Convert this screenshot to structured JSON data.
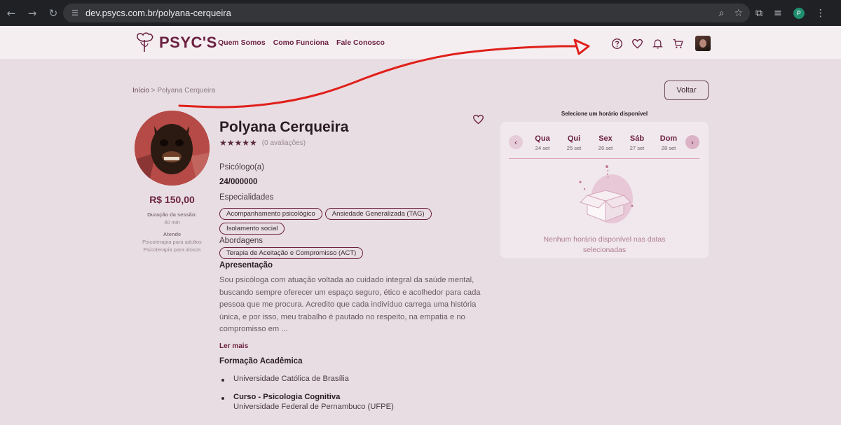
{
  "browser": {
    "url": "dev.psycs.com.br/polyana-cerqueira",
    "profile_initial": "P"
  },
  "header": {
    "logo_text": "PSYC'S",
    "nav": [
      "Quem Somos",
      "Como Funciona",
      "Fale Conosco"
    ]
  },
  "breadcrumb": {
    "home": "Início",
    "separator": " > ",
    "current": "Polyana Cerqueira"
  },
  "back_button": "Voltar",
  "profile": {
    "name": "Polyana Cerqueira",
    "rating": 5,
    "stars": "★★★★★",
    "reviews": "(0 avaliações)",
    "price": "R$ 150,00",
    "session_label": "Duração da sessão:",
    "session_value": "40 min",
    "attends_label": "Atende",
    "attends": [
      "Psicoterapia para adultos",
      "Psicoterapia para idosos"
    ],
    "role": "Psicólogo(a)",
    "crp": "24/000000",
    "specialties_label": "Especialidades",
    "specialties": [
      "Acompanhamento psicológico",
      "Ansiedade Generalizada (TAG)",
      "Isolamento social"
    ],
    "approaches_label": "Abordagens",
    "approaches": [
      "Terapia de Aceitação e Compromisso (ACT)"
    ],
    "presentation_label": "Apresentação",
    "presentation": "Sou psicóloga com atuação voltada ao cuidado integral da saúde mental, buscando sempre oferecer um espaço seguro, ético e acolhedor para cada pessoa que me procura. Acredito que cada indivíduo carrega uma história única, e por isso, meu trabalho é pautado no respeito, na empatia e no compromisso em ...",
    "read_more": "Ler mais",
    "education_label": "Formação Acadêmica",
    "education": [
      {
        "title": "",
        "institution": "Universidade Católica de Brasília"
      },
      {
        "title": "Curso - Psicologia Cognitiva",
        "institution": "Universidade Federal de Pernambuco (UFPE)"
      }
    ]
  },
  "schedule": {
    "title": "Selecione um horário disponível",
    "days": [
      {
        "name": "Qua",
        "date": "24 set"
      },
      {
        "name": "Qui",
        "date": "25 set"
      },
      {
        "name": "Sex",
        "date": "26 set"
      },
      {
        "name": "Sáb",
        "date": "27 set"
      },
      {
        "name": "Dom",
        "date": "28 set"
      }
    ],
    "empty_message": "Nenhum horário disponível nas datas selecionadas"
  },
  "colors": {
    "brand": "#6b2140",
    "background": "#e8dde2",
    "annotation": "#e0201b"
  }
}
